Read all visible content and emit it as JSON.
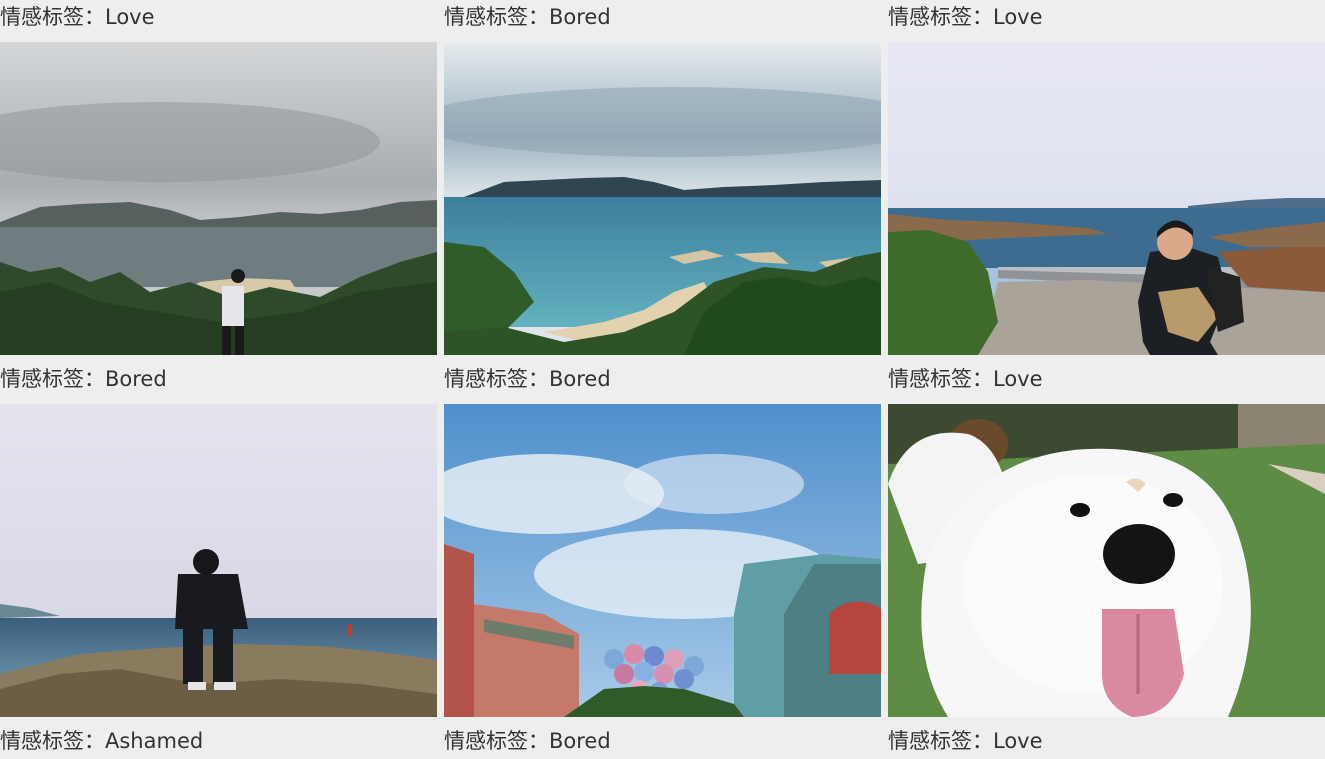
{
  "captions": {
    "row0": [
      "情感标签：Love",
      "情感标签：Bored",
      "情感标签：Love"
    ],
    "row1": [
      "情感标签：Bored",
      "情感标签：Bored",
      "情感标签：Love"
    ],
    "row2": [
      "情感标签：Ashamed",
      "情感标签：Bored",
      "情感标签：Love"
    ]
  },
  "photos": [
    {
      "name": "cloudy-bay-photo"
    },
    {
      "name": "blue-bay-photo"
    },
    {
      "name": "coastal-path-photo"
    },
    {
      "name": "rocky-shore-photo"
    },
    {
      "name": "theme-park-photo"
    },
    {
      "name": "white-dog-photo"
    }
  ]
}
